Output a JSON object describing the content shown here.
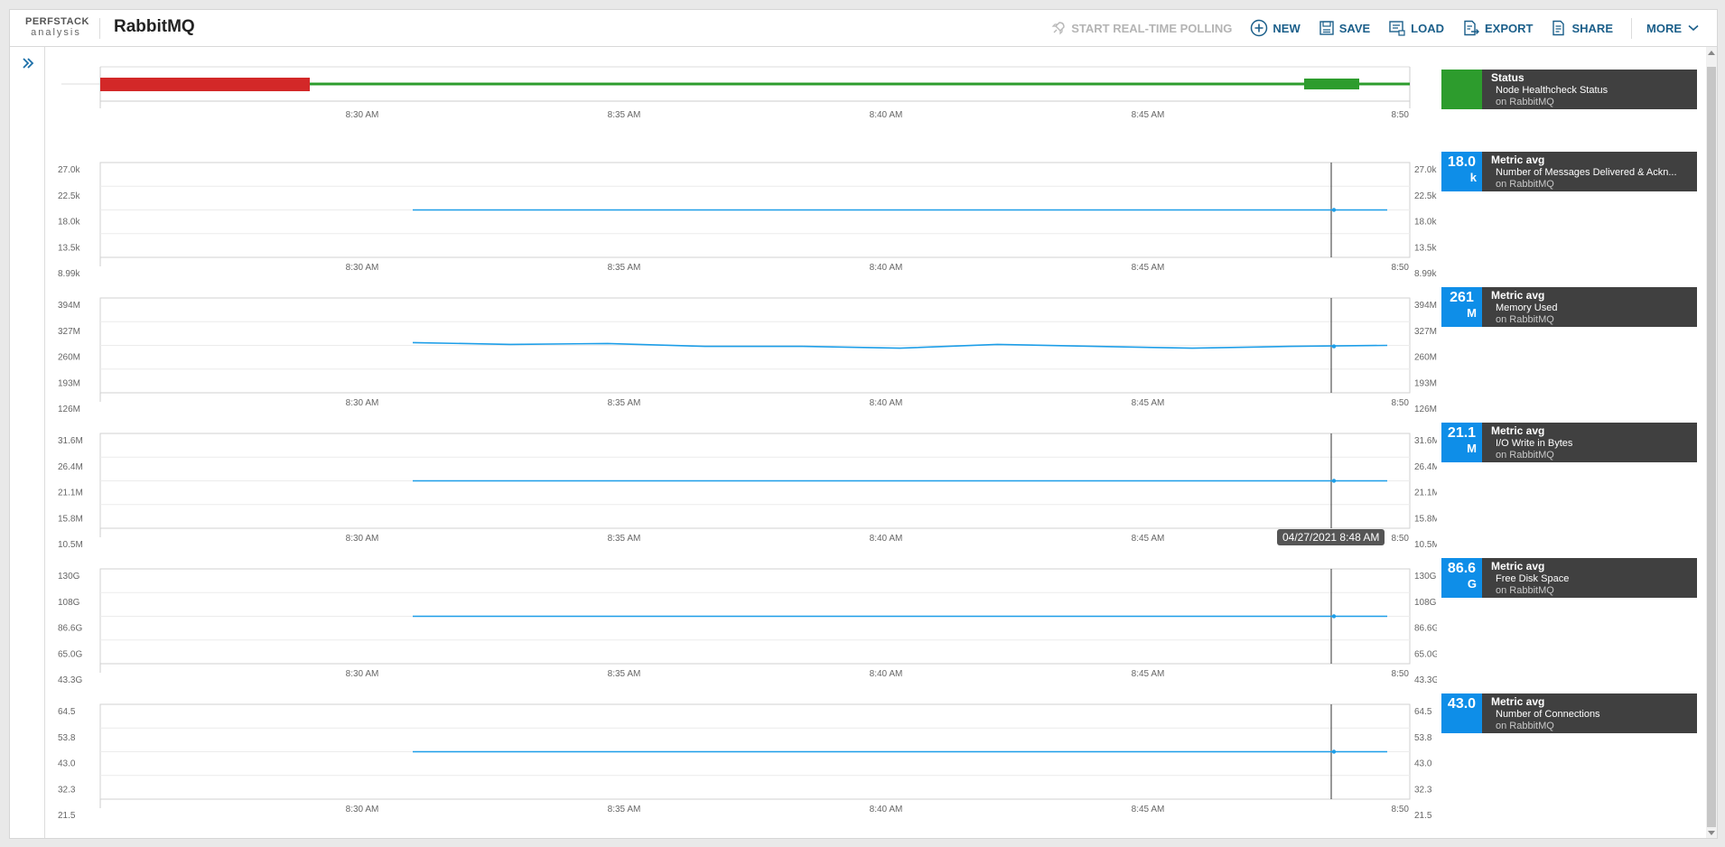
{
  "app": {
    "logo_top": "PERFSTACK",
    "logo_bottom": "analysis",
    "title": "RabbitMQ"
  },
  "toolbar": {
    "polling": "START REAL-TIME POLLING",
    "new": "NEW",
    "save": "SAVE",
    "load": "LOAD",
    "export": "EXPORT",
    "share": "SHARE",
    "more": "MORE"
  },
  "time_axis": {
    "ticks": [
      "8:30 AM",
      "8:35 AM",
      "8:40 AM",
      "8:45 AM",
      "8:50"
    ]
  },
  "status_panel": {
    "status_color": "#2d9c2d",
    "down_color": "#d32828",
    "head": "Status",
    "metric": "Node Healthcheck Status",
    "node": "on RabbitMQ"
  },
  "hover": {
    "tooltip": "04/27/2021 8:48 AM"
  },
  "colors": {
    "accent": "#0e8ee8",
    "line": "#1d9ee8",
    "legend_bg": "#404040"
  },
  "metric_panels": [
    {
      "value": "18.0",
      "unit": "k",
      "head": "Metric avg",
      "metric": "Number of Messages Delivered & Ackn...",
      "node": "on RabbitMQ",
      "yticks": [
        "27.0k",
        "22.5k",
        "18.0k",
        "13.5k",
        "8.99k"
      ]
    },
    {
      "value": "261",
      "unit": "M",
      "head": "Metric avg",
      "metric": "Memory Used",
      "node": "on RabbitMQ",
      "yticks": [
        "394M",
        "327M",
        "260M",
        "193M",
        "126M"
      ]
    },
    {
      "value": "21.1",
      "unit": "M",
      "head": "Metric avg",
      "metric": "I/O Write in Bytes",
      "node": "on RabbitMQ",
      "yticks": [
        "31.6M",
        "26.4M",
        "21.1M",
        "15.8M",
        "10.5M"
      ]
    },
    {
      "value": "86.6",
      "unit": "G",
      "head": "Metric avg",
      "metric": "Free Disk Space",
      "node": "on RabbitMQ",
      "yticks": [
        "130G",
        "108G",
        "86.6G",
        "65.0G",
        "43.3G"
      ]
    },
    {
      "value": "43.0",
      "unit": "",
      "head": "Metric avg",
      "metric": "Number of Connections",
      "node": "on RabbitMQ",
      "yticks": [
        "64.5",
        "53.8",
        "43.0",
        "32.3",
        "21.5"
      ]
    }
  ]
}
